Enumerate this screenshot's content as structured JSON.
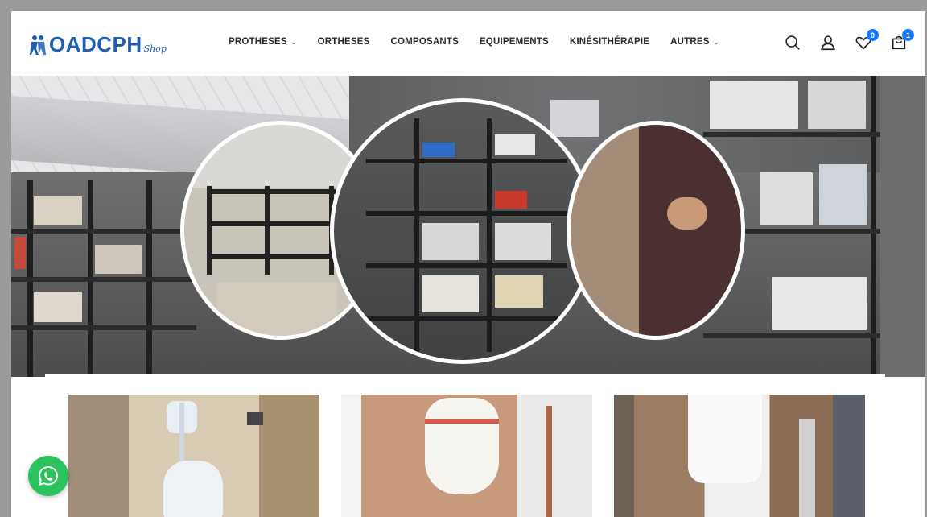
{
  "header": {
    "logo_text": "OADCPH",
    "logo_sub": "Shop",
    "nav": [
      {
        "label": "PROTHESES",
        "has_dropdown": true
      },
      {
        "label": "ORTHESES",
        "has_dropdown": false
      },
      {
        "label": "COMPOSANTS",
        "has_dropdown": false
      },
      {
        "label": "EQUIPEMENTS",
        "has_dropdown": false
      },
      {
        "label": "KINÉSITHÉRAPIE",
        "has_dropdown": false
      },
      {
        "label": "AUTRES",
        "has_dropdown": true
      }
    ],
    "wishlist_count": "0",
    "cart_count": "1"
  },
  "icons": {
    "search": "search-icon",
    "account": "user-icon",
    "wishlist": "heart-icon",
    "cart": "shopping-bag-icon",
    "whatsapp": "whatsapp-icon"
  },
  "colors": {
    "brand": "#1f5fb0",
    "badge": "#1677ff",
    "whatsapp": "#2bc15c"
  },
  "hero": {
    "images": [
      "warehouse-shelves",
      "circle-showroom",
      "circle-shelves",
      "circle-boards"
    ]
  },
  "cards": [
    {
      "image": "seating-orthosis"
    },
    {
      "image": "thoracic-brace"
    },
    {
      "image": "patient-fitting"
    }
  ]
}
